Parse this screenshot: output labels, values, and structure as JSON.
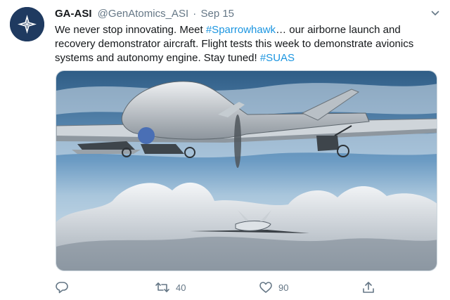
{
  "tweet": {
    "author_name": "GA-ASI",
    "author_handle": "@GenAtomics_ASI",
    "separator": "·",
    "date": "Sep 15",
    "text_parts": [
      "We never stop innovating. Meet ",
      "#Sparrowhawk",
      "… our airborne launch and recovery demonstrator aircraft. Flight tests this week to demonstrate avionics systems and autonomy engine. Stay tuned! ",
      "#SUAS"
    ],
    "actions": {
      "reply_count": "",
      "retweet_count": "40",
      "like_count": "90"
    }
  },
  "colors": {
    "hashtag": "#1b95e0",
    "secondary_text": "#657786",
    "avatar_bg": "#1d3557"
  },
  "icons": [
    "caret-down-icon",
    "reply-icon",
    "retweet-icon",
    "like-icon",
    "share-icon",
    "logo-icon"
  ]
}
